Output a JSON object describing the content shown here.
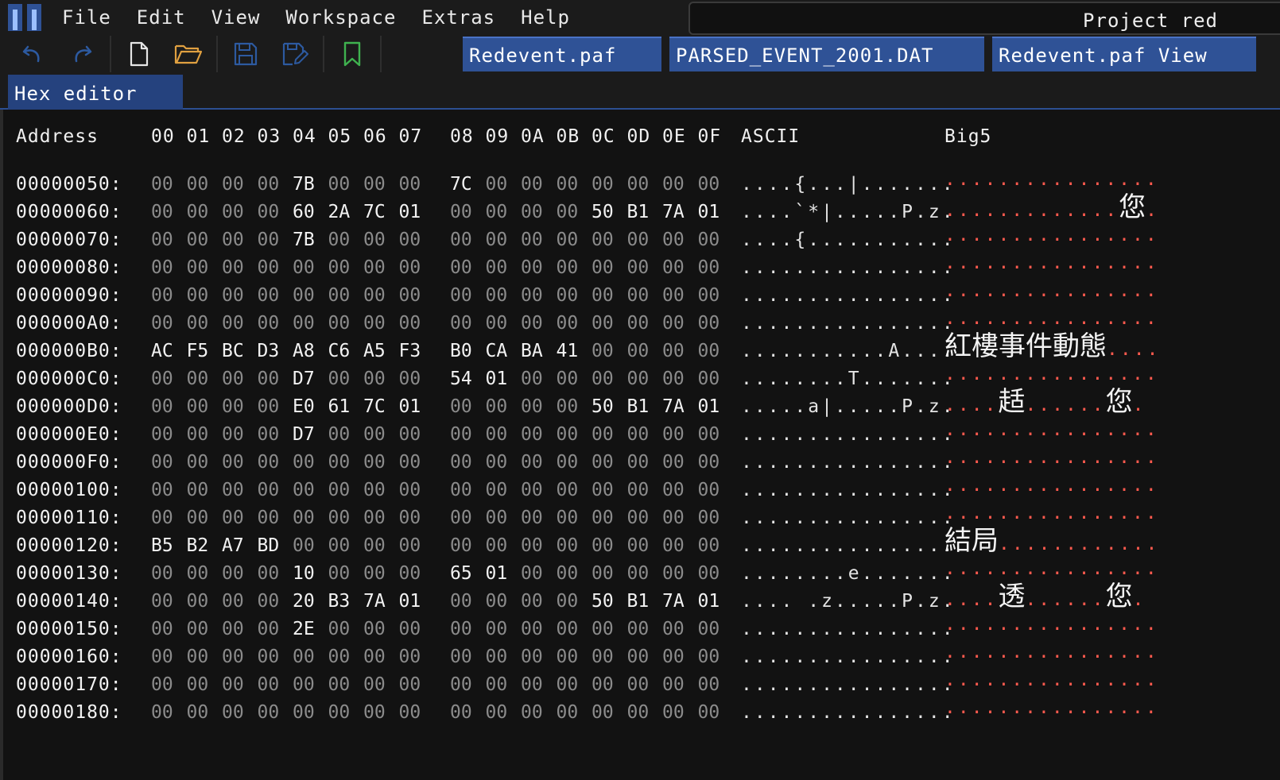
{
  "menu": [
    "File",
    "Edit",
    "View",
    "Workspace",
    "Extras",
    "Help"
  ],
  "project_title": "Project red",
  "toolbar": {
    "icons": [
      "undo-icon",
      "redo-icon",
      "new-file-icon",
      "open-folder-icon",
      "save-icon",
      "save-as-icon",
      "bookmark-icon"
    ]
  },
  "file_tabs": [
    "Redevent.paf",
    "PARSED_EVENT_2001.DAT",
    "Redevent.paf View"
  ],
  "view_tab": "Hex editor",
  "colors": {
    "accent": "#2f5296",
    "big5_dot": "#ff5a4e",
    "folder_icon": "#e0a040",
    "bookmark_icon": "#3fb24f",
    "disabled_icon": "#2d5aa0"
  },
  "header": {
    "address": "Address",
    "offsets": [
      "00",
      "01",
      "02",
      "03",
      "04",
      "05",
      "06",
      "07",
      "08",
      "09",
      "0A",
      "0B",
      "0C",
      "0D",
      "0E",
      "0F"
    ],
    "ascii": "ASCII",
    "big5": "Big5"
  },
  "rows": [
    {
      "address": "00000050:",
      "bytes": [
        "00",
        "00",
        "00",
        "00",
        "7B",
        "00",
        "00",
        "00",
        "7C",
        "00",
        "00",
        "00",
        "00",
        "00",
        "00",
        "00"
      ],
      "ascii": "....{...|.......",
      "big5": "................"
    },
    {
      "address": "00000060:",
      "bytes": [
        "00",
        "00",
        "00",
        "00",
        "60",
        "2A",
        "7C",
        "01",
        "00",
        "00",
        "00",
        "00",
        "50",
        "B1",
        "7A",
        "01"
      ],
      "ascii": "....`*|.....P.z.",
      "big5": ".............您."
    },
    {
      "address": "00000070:",
      "bytes": [
        "00",
        "00",
        "00",
        "00",
        "7B",
        "00",
        "00",
        "00",
        "00",
        "00",
        "00",
        "00",
        "00",
        "00",
        "00",
        "00"
      ],
      "ascii": "....{...........",
      "big5": "................"
    },
    {
      "address": "00000080:",
      "bytes": [
        "00",
        "00",
        "00",
        "00",
        "00",
        "00",
        "00",
        "00",
        "00",
        "00",
        "00",
        "00",
        "00",
        "00",
        "00",
        "00"
      ],
      "ascii": "................",
      "big5": "................"
    },
    {
      "address": "00000090:",
      "bytes": [
        "00",
        "00",
        "00",
        "00",
        "00",
        "00",
        "00",
        "00",
        "00",
        "00",
        "00",
        "00",
        "00",
        "00",
        "00",
        "00"
      ],
      "ascii": "................",
      "big5": "................"
    },
    {
      "address": "000000A0:",
      "bytes": [
        "00",
        "00",
        "00",
        "00",
        "00",
        "00",
        "00",
        "00",
        "00",
        "00",
        "00",
        "00",
        "00",
        "00",
        "00",
        "00"
      ],
      "ascii": "................",
      "big5": "................"
    },
    {
      "address": "000000B0:",
      "bytes": [
        "AC",
        "F5",
        "BC",
        "D3",
        "A8",
        "C6",
        "A5",
        "F3",
        "B0",
        "CA",
        "BA",
        "41",
        "00",
        "00",
        "00",
        "00"
      ],
      "ascii": "...........A....",
      "big5": "紅樓事件動態...."
    },
    {
      "address": "000000C0:",
      "bytes": [
        "00",
        "00",
        "00",
        "00",
        "D7",
        "00",
        "00",
        "00",
        "54",
        "01",
        "00",
        "00",
        "00",
        "00",
        "00",
        "00"
      ],
      "ascii": "........T.......",
      "big5": "................"
    },
    {
      "address": "000000D0:",
      "bytes": [
        "00",
        "00",
        "00",
        "00",
        "E0",
        "61",
        "7C",
        "01",
        "00",
        "00",
        "00",
        "00",
        "50",
        "B1",
        "7A",
        "01"
      ],
      "ascii": ".....a|.....P.z.",
      "big5": "....趏......您."
    },
    {
      "address": "000000E0:",
      "bytes": [
        "00",
        "00",
        "00",
        "00",
        "D7",
        "00",
        "00",
        "00",
        "00",
        "00",
        "00",
        "00",
        "00",
        "00",
        "00",
        "00"
      ],
      "ascii": "................",
      "big5": "................"
    },
    {
      "address": "000000F0:",
      "bytes": [
        "00",
        "00",
        "00",
        "00",
        "00",
        "00",
        "00",
        "00",
        "00",
        "00",
        "00",
        "00",
        "00",
        "00",
        "00",
        "00"
      ],
      "ascii": "................",
      "big5": "................"
    },
    {
      "address": "00000100:",
      "bytes": [
        "00",
        "00",
        "00",
        "00",
        "00",
        "00",
        "00",
        "00",
        "00",
        "00",
        "00",
        "00",
        "00",
        "00",
        "00",
        "00"
      ],
      "ascii": "................",
      "big5": "................"
    },
    {
      "address": "00000110:",
      "bytes": [
        "00",
        "00",
        "00",
        "00",
        "00",
        "00",
        "00",
        "00",
        "00",
        "00",
        "00",
        "00",
        "00",
        "00",
        "00",
        "00"
      ],
      "ascii": "................",
      "big5": "................"
    },
    {
      "address": "00000120:",
      "bytes": [
        "B5",
        "B2",
        "A7",
        "BD",
        "00",
        "00",
        "00",
        "00",
        "00",
        "00",
        "00",
        "00",
        "00",
        "00",
        "00",
        "00"
      ],
      "ascii": "................",
      "big5": "結局............"
    },
    {
      "address": "00000130:",
      "bytes": [
        "00",
        "00",
        "00",
        "00",
        "10",
        "00",
        "00",
        "00",
        "65",
        "01",
        "00",
        "00",
        "00",
        "00",
        "00",
        "00"
      ],
      "ascii": "........e.......",
      "big5": "................"
    },
    {
      "address": "00000140:",
      "bytes": [
        "00",
        "00",
        "00",
        "00",
        "20",
        "B3",
        "7A",
        "01",
        "00",
        "00",
        "00",
        "00",
        "50",
        "B1",
        "7A",
        "01"
      ],
      "ascii": ".... .z.....P.z.",
      "big5": "....透......您."
    },
    {
      "address": "00000150:",
      "bytes": [
        "00",
        "00",
        "00",
        "00",
        "2E",
        "00",
        "00",
        "00",
        "00",
        "00",
        "00",
        "00",
        "00",
        "00",
        "00",
        "00"
      ],
      "ascii": "................",
      "big5": "................"
    },
    {
      "address": "00000160:",
      "bytes": [
        "00",
        "00",
        "00",
        "00",
        "00",
        "00",
        "00",
        "00",
        "00",
        "00",
        "00",
        "00",
        "00",
        "00",
        "00",
        "00"
      ],
      "ascii": "................",
      "big5": "................"
    },
    {
      "address": "00000170:",
      "bytes": [
        "00",
        "00",
        "00",
        "00",
        "00",
        "00",
        "00",
        "00",
        "00",
        "00",
        "00",
        "00",
        "00",
        "00",
        "00",
        "00"
      ],
      "ascii": "................",
      "big5": "................"
    },
    {
      "address": "00000180:",
      "bytes": [
        "00",
        "00",
        "00",
        "00",
        "00",
        "00",
        "00",
        "00",
        "00",
        "00",
        "00",
        "00",
        "00",
        "00",
        "00",
        "00"
      ],
      "ascii": "................",
      "big5": "................"
    }
  ]
}
